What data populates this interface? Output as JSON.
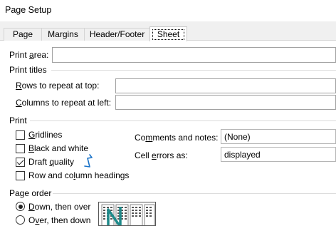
{
  "window": {
    "title": "Page Setup"
  },
  "tabs": [
    {
      "label": "Page",
      "active": false
    },
    {
      "label": "Margins",
      "active": false
    },
    {
      "label": "Header/Footer",
      "active": false
    },
    {
      "label": "Sheet",
      "active": true
    }
  ],
  "print_area": {
    "label_pre": "Print ",
    "label_u": "a",
    "label_post": "rea:",
    "value": ""
  },
  "print_titles": {
    "heading": "Print titles",
    "rows_label_u": "R",
    "rows_label_post": "ows to repeat at top:",
    "rows_value": "",
    "cols_label_u": "C",
    "cols_label_post": "olumns to repeat at left:",
    "cols_value": ""
  },
  "print": {
    "heading": "Print",
    "options": [
      {
        "pre": "",
        "u": "G",
        "post": "ridlines",
        "checked": false
      },
      {
        "pre": "",
        "u": "B",
        "post": "lack and white",
        "checked": false
      },
      {
        "pre": "Draft ",
        "u": "q",
        "post": "uality",
        "checked": true
      },
      {
        "pre": "Row and co",
        "u": "l",
        "post": "umn headings",
        "checked": false
      }
    ],
    "comments_label_pre": "Co",
    "comments_label_u": "m",
    "comments_label_post": "ments and notes:",
    "comments_value": "(None)",
    "errors_label_pre": "Cell ",
    "errors_label_u": "e",
    "errors_label_post": "rrors as:",
    "errors_value": "displayed"
  },
  "page_order": {
    "heading": "Page order",
    "options": [
      {
        "pre": "",
        "u": "D",
        "post": "own, then over",
        "checked": true
      },
      {
        "pre": "O",
        "u": "v",
        "post": "er, then down",
        "checked": false
      }
    ]
  },
  "colors": {
    "accent": "#1a73c8",
    "preview_arrow": "#1f8a8a"
  }
}
